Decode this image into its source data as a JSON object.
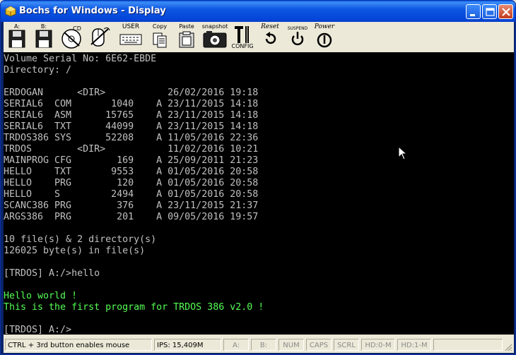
{
  "window": {
    "title": "Bochs for Windows - Display"
  },
  "toolbar": {
    "items": [
      {
        "id": "floppy-a",
        "label": "A:"
      },
      {
        "id": "floppy-b",
        "label": "B:"
      },
      {
        "id": "cdrom",
        "label": "CD"
      },
      {
        "id": "mouse",
        "label": ""
      },
      {
        "id": "user",
        "label": "USER"
      },
      {
        "id": "copy",
        "label": "Copy"
      },
      {
        "id": "paste",
        "label": "Paste"
      },
      {
        "id": "snapshot",
        "label": "snapshot"
      },
      {
        "id": "config",
        "label": "CONFIG"
      },
      {
        "id": "reset",
        "label": "Reset"
      },
      {
        "id": "suspend",
        "label": "SUSPEND"
      },
      {
        "id": "power",
        "label": "Power"
      }
    ]
  },
  "console": {
    "lines": [
      {
        "text": "Volume Serial No: 6E62-EBDE",
        "color": "gray"
      },
      {
        "text": "Directory: /",
        "color": "gray"
      },
      {
        "text": "",
        "color": "gray"
      },
      {
        "text": "ERDOGAN      <DIR>           26/02/2016 19:18",
        "color": "gray"
      },
      {
        "text": "SERIAL6  COM       1040    A 23/11/2015 14:18",
        "color": "gray"
      },
      {
        "text": "SERIAL6  ASM      15765    A 23/11/2015 14:18",
        "color": "gray"
      },
      {
        "text": "SERIAL6  TXT      44099    A 23/11/2015 14:18",
        "color": "gray"
      },
      {
        "text": "TRDOS386 SYS      52208    A 11/05/2016 22:36",
        "color": "gray"
      },
      {
        "text": "TRDOS        <DIR>           11/02/2016 10:21",
        "color": "gray"
      },
      {
        "text": "MAINPROG CFG        169    A 25/09/2011 21:23",
        "color": "gray"
      },
      {
        "text": "HELLO    TXT       9553    A 01/05/2016 20:58",
        "color": "gray"
      },
      {
        "text": "HELLO    PRG        120    A 01/05/2016 20:58",
        "color": "gray"
      },
      {
        "text": "HELLO    S         2494    A 01/05/2016 20:58",
        "color": "gray"
      },
      {
        "text": "SCANC386 PRG        376    A 23/11/2015 21:37",
        "color": "gray"
      },
      {
        "text": "ARGS386  PRG        201    A 09/05/2016 19:57",
        "color": "gray"
      },
      {
        "text": "",
        "color": "gray"
      },
      {
        "text": "10 file(s) & 2 directory(s)",
        "color": "gray"
      },
      {
        "text": "126025 byte(s) in file(s)",
        "color": "gray"
      },
      {
        "text": "",
        "color": "gray"
      },
      {
        "text": "[TRDOS] A:/>hello",
        "color": "gray"
      },
      {
        "text": "",
        "color": "gray"
      },
      {
        "text": "Hello world !",
        "color": "green"
      },
      {
        "text": "This is the first program for TRDOS 386 v2.0 !",
        "color": "green"
      },
      {
        "text": "",
        "color": "gray"
      },
      {
        "text": "[TRDOS] A:/>",
        "color": "gray"
      }
    ]
  },
  "statusbar": {
    "hint": "CTRL + 3rd button enables mouse",
    "ips": "IPS: 15,409M",
    "a": "A:",
    "b": "B:",
    "num": "NUM",
    "caps": "CAPS",
    "scrl": "SCRL",
    "hd0": "HD:0-M",
    "hd1": "HD:1-M"
  },
  "colors": {
    "console_gray": "#c0c0c0",
    "console_green": "#55ff55",
    "titlebar_blue": "#0345d8"
  }
}
